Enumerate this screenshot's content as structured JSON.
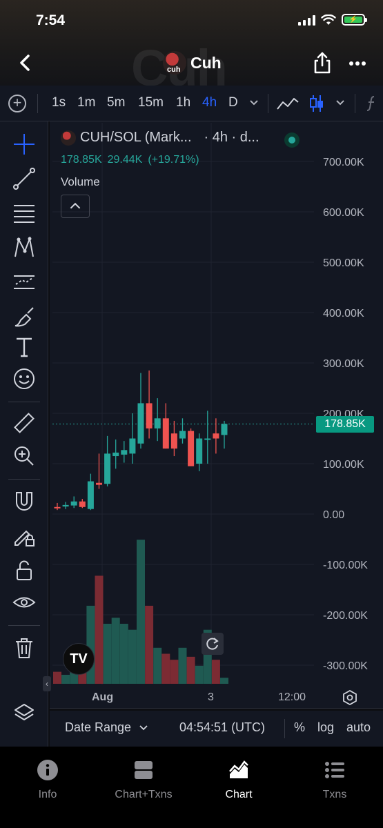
{
  "status_bar": {
    "time": "7:54",
    "battery": "⚡"
  },
  "header": {
    "watermark": "Cuh",
    "title": "Cuh",
    "avatar_text": "cuh"
  },
  "timeframes": [
    "1s",
    "1m",
    "5m",
    "15m",
    "1h",
    "4h",
    "D"
  ],
  "active_timeframe": "4h",
  "legend": {
    "symbol": "CUH/SOL (Mark...",
    "interval": "· 4h · d...",
    "price": "178.85K",
    "change": "29.44K",
    "change_pct": "(+19.71%)",
    "volume_label": "Volume"
  },
  "price_axis": [
    "700.00K",
    "600.00K",
    "500.00K",
    "400.00K",
    "300.00K",
    "200.00K",
    "100.00K",
    "0.00",
    "-100.00K",
    "-200.00K",
    "-300.00K"
  ],
  "last_price_badge": "178.85K",
  "time_axis": [
    "Aug",
    "3",
    "12:00"
  ],
  "bottom_controls": {
    "date_range": "Date Range",
    "clock": "04:54:51 (UTC)",
    "percent": "%",
    "log": "log",
    "auto": "auto"
  },
  "tabs": [
    {
      "label": "Info",
      "icon": "info-icon"
    },
    {
      "label": "Chart+Txns",
      "icon": "split-view-icon"
    },
    {
      "label": "Chart",
      "icon": "chart-icon"
    },
    {
      "label": "Txns",
      "icon": "list-icon"
    }
  ],
  "active_tab": "Chart",
  "colors": {
    "up": "#26a69a",
    "down": "#ef5350",
    "accent": "#2962ff",
    "price_badge": "#089981"
  },
  "chart_data": {
    "type": "candlestick",
    "symbol": "CUH/SOL",
    "interval": "4h",
    "y_unit": "K",
    "ylim": [
      -330,
      720
    ],
    "candles": [
      {
        "o": 14,
        "h": 22,
        "l": 8,
        "c": 12
      },
      {
        "o": 15,
        "h": 24,
        "l": 10,
        "c": 18
      },
      {
        "o": 17,
        "h": 35,
        "l": 12,
        "c": 25
      },
      {
        "o": 25,
        "h": 30,
        "l": 12,
        "c": 14
      },
      {
        "o": 10,
        "h": 80,
        "l": 8,
        "c": 65
      },
      {
        "o": 62,
        "h": 120,
        "l": 50,
        "c": 58
      },
      {
        "o": 60,
        "h": 155,
        "l": 55,
        "c": 120
      },
      {
        "o": 115,
        "h": 148,
        "l": 90,
        "c": 122
      },
      {
        "o": 118,
        "h": 145,
        "l": 102,
        "c": 127
      },
      {
        "o": 120,
        "h": 200,
        "l": 100,
        "c": 150
      },
      {
        "o": 140,
        "h": 280,
        "l": 130,
        "c": 220
      },
      {
        "o": 220,
        "h": 285,
        "l": 150,
        "c": 170
      },
      {
        "o": 170,
        "h": 230,
        "l": 145,
        "c": 190
      },
      {
        "o": 190,
        "h": 220,
        "l": 130,
        "c": 130
      },
      {
        "o": 160,
        "h": 185,
        "l": 115,
        "c": 130
      },
      {
        "o": 150,
        "h": 190,
        "l": 140,
        "c": 165
      },
      {
        "o": 165,
        "h": 170,
        "l": 100,
        "c": 95
      },
      {
        "o": 100,
        "h": 160,
        "l": 85,
        "c": 150
      },
      {
        "o": 150,
        "h": 205,
        "l": 100,
        "c": 150
      },
      {
        "o": 160,
        "h": 190,
        "l": 120,
        "c": 150
      },
      {
        "o": 157,
        "h": 185,
        "l": 130,
        "c": 178.85
      }
    ],
    "volume": [
      4,
      3,
      5,
      4,
      26,
      36,
      20,
      22,
      20,
      18,
      48,
      26,
      12,
      10,
      8,
      12,
      9,
      6,
      18,
      8,
      2
    ]
  }
}
